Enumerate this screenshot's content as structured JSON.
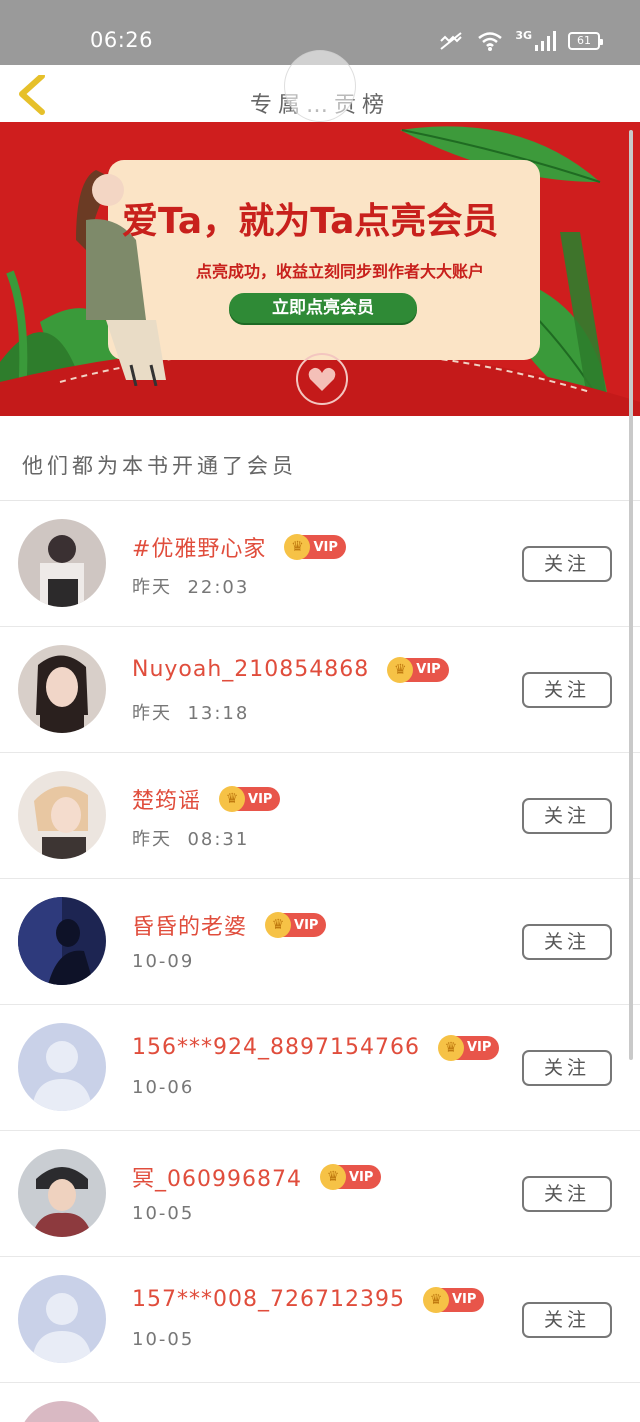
{
  "status_bar": {
    "time": "06:26",
    "network": "3G",
    "battery": "61"
  },
  "header": {
    "title": "专属…贡榜"
  },
  "banner": {
    "title": "爱Ta，就为Ta点亮会员",
    "subtitle": "点亮成功，收益立刻同步到作者大大账户",
    "cta": "立即点亮会员"
  },
  "section": {
    "heading": "他们都为本书开通了会员"
  },
  "vip_label": "VIP",
  "follow_label": "关注",
  "members": [
    {
      "name": "#优雅野心家",
      "time": "昨天  22:03"
    },
    {
      "name": "Nuyoah_210854868",
      "time": "昨天  13:18"
    },
    {
      "name": "楚筠谣",
      "time": "昨天  08:31"
    },
    {
      "name": "昏昏的老婆",
      "time": "10-09"
    },
    {
      "name": "156***924_8897154766",
      "time": "10-06"
    },
    {
      "name": "冥_060996874",
      "time": "10-05"
    },
    {
      "name": "157***008_726712395",
      "time": "10-05"
    }
  ],
  "colors": {
    "accent_red": "#e04d3c",
    "banner_red": "#cf1e1e",
    "banner_green": "#2f8a36",
    "vip_gold": "#f6c246"
  }
}
